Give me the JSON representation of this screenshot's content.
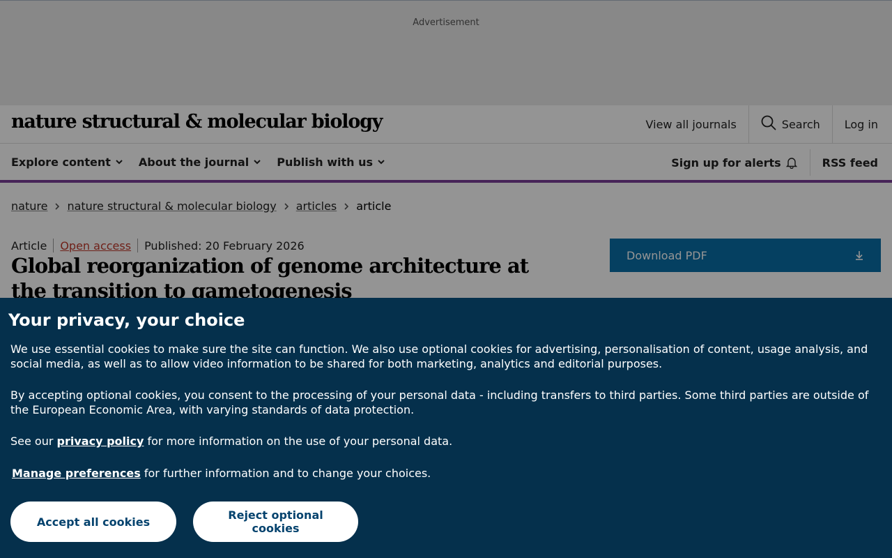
{
  "ad": {
    "label": "Advertisement"
  },
  "header": {
    "logo": "nature structural & molecular biology",
    "view_all": "View all journals",
    "search": "Search",
    "login": "Log in"
  },
  "nav": {
    "items": [
      {
        "label": "Explore content"
      },
      {
        "label": "About the journal"
      },
      {
        "label": "Publish with us"
      }
    ],
    "alerts": "Sign up for alerts",
    "rss": "RSS feed",
    "accent_color": "#7b3f98"
  },
  "breadcrumb": [
    "nature",
    "nature structural & molecular biology",
    "articles",
    "article"
  ],
  "article": {
    "type": "Article",
    "access": "Open access",
    "published": "Published: 20 February 2026",
    "title": "Global reorganization of genome architecture at the transition to gametogenesis"
  },
  "pdf": {
    "label": "Download PDF",
    "color": "#0a6fa8"
  },
  "cookie": {
    "title": "Your privacy, your choice",
    "p1": "We use essential cookies to make sure the site can function. We also use optional cookies for advertising, personalisation of content, usage analysis, and social media, as well as to allow video information to be shared for both marketing, analytics and editorial purposes.",
    "p2": "By accepting optional cookies, you consent to the processing of your personal data - including transfers to third parties. Some third parties are outside of the European Economic Area, with varying standards of data protection.",
    "p3_pre": "See our ",
    "p3_link": "privacy policy",
    "p3_post": " for more information on the use of your personal data.",
    "p4_link": "Manage preferences",
    "p4_post": " for further information and to change your choices.",
    "accept": "Accept all cookies",
    "reject": "Reject optional cookies",
    "bg_color": "#05304c"
  }
}
